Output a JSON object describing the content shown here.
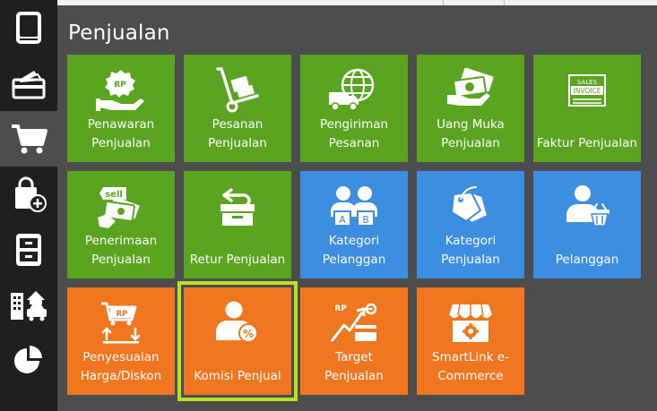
{
  "background_hint": "100",
  "panel": {
    "title": "Penjualan"
  },
  "sidebar": {
    "items": [
      {
        "name": "book-icon"
      },
      {
        "name": "wallet-cards-icon"
      },
      {
        "name": "shopping-cart-icon",
        "active": true
      },
      {
        "name": "shopping-bag-add-icon"
      },
      {
        "name": "cabinet-icon"
      },
      {
        "name": "building-car-icon"
      },
      {
        "name": "pie-chart-icon"
      }
    ]
  },
  "tiles": [
    {
      "label": "Penawaran\nPenjualan",
      "icon": "rp-badge-hand-icon",
      "color": "green"
    },
    {
      "label": "Pesanan\nPenjualan",
      "icon": "hand-truck-icon",
      "color": "green"
    },
    {
      "label": "Pengiriman\nPesanan",
      "icon": "globe-truck-icon",
      "color": "green"
    },
    {
      "label": "Uang Muka\nPenjualan",
      "icon": "money-stack-icon",
      "color": "green"
    },
    {
      "label": "Faktur Penjualan",
      "icon": "sales-invoice-icon",
      "color": "green",
      "icon_text_1": "SALES",
      "icon_text_2": "INVOICE"
    },
    {
      "label": "Penerimaan\nPenjualan",
      "icon": "sell-money-icon",
      "color": "green",
      "icon_text": "sell"
    },
    {
      "label": "Retur Penjualan",
      "icon": "return-box-icon",
      "color": "green"
    },
    {
      "label": "Kategori\nPelanggan",
      "icon": "customer-category-icon",
      "color": "blue",
      "icon_text_1": "A",
      "icon_text_2": "B"
    },
    {
      "label": "Kategori\nPenjualan",
      "icon": "price-tags-icon",
      "color": "blue"
    },
    {
      "label": "Pelanggan",
      "icon": "customer-basket-icon",
      "color": "blue"
    },
    {
      "label": "Penyesuaian\nHarga/Diskon",
      "icon": "price-adjust-icon",
      "color": "orange",
      "icon_text": "RP"
    },
    {
      "label": "Komisi Penjual",
      "icon": "person-percent-icon",
      "color": "orange",
      "selected": true
    },
    {
      "label": "Target\nPenjualan",
      "icon": "sales-target-icon",
      "color": "orange",
      "icon_text": "RP"
    },
    {
      "label": "SmartLink e-\nCommerce",
      "icon": "store-gear-icon",
      "color": "orange"
    }
  ],
  "colors": {
    "green": "#5aa51f",
    "blue": "#3b8ee0",
    "orange": "#f07620",
    "selected_outline": "#b6e02a",
    "sidebar": "#1f1f1f",
    "panel": "#4d4d4d"
  }
}
